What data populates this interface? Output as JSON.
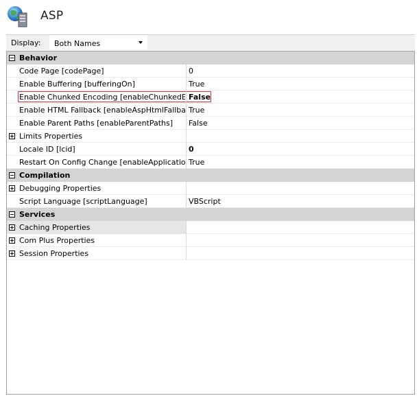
{
  "title": "ASP",
  "display": {
    "label": "Display:",
    "value": "Both Names"
  },
  "categories": [
    {
      "name": "Behavior",
      "rows": [
        {
          "name": "Code Page [codePage]",
          "value": "0"
        },
        {
          "name": "Enable Buffering [bufferingOn]",
          "value": "True"
        },
        {
          "name": "Enable Chunked Encoding [enableChunkedEn",
          "value": "False"
        },
        {
          "name": "Enable HTML Fallback [enableAspHtmlFallbac",
          "value": "True"
        },
        {
          "name": "Enable Parent Paths [enableParentPaths]",
          "value": "False"
        },
        {
          "name": "Limits Properties",
          "value": ""
        },
        {
          "name": "Locale ID [lcid]",
          "value": "0"
        },
        {
          "name": "Restart On Config Change [enableApplication",
          "value": "True"
        }
      ]
    },
    {
      "name": "Compilation",
      "rows": [
        {
          "name": "Debugging Properties",
          "value": ""
        },
        {
          "name": "Script Language [scriptLanguage]",
          "value": "VBScript"
        }
      ]
    },
    {
      "name": "Services",
      "rows": [
        {
          "name": "Caching Properties",
          "value": ""
        },
        {
          "name": "Com Plus Properties",
          "value": ""
        },
        {
          "name": "Session Properties",
          "value": ""
        }
      ]
    }
  ]
}
